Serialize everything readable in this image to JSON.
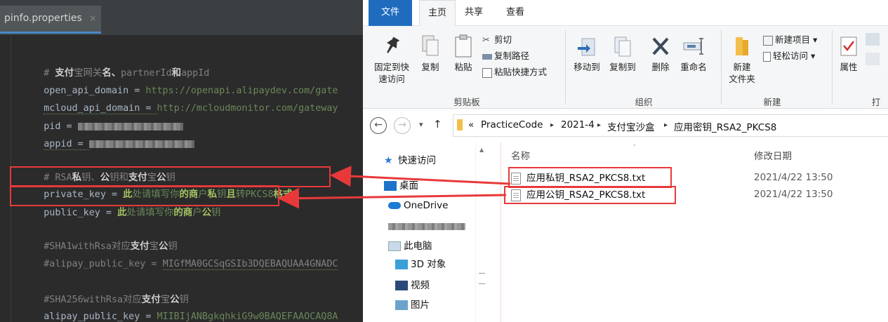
{
  "editor": {
    "tab_title": "pinfo.properties",
    "tab_close": "×",
    "lines": {
      "l1_comment_hash": "# ",
      "l1_p1": "支付",
      "l1_p2": "宝网关",
      "l1_p3": "名、",
      "l1_p4": "partnerId",
      "l1_p5": "和",
      "l1_p6": "appId",
      "l2_key": "open_api_domain = ",
      "l2_val": "https://openapi.alipaydev.com/gate",
      "l3_key": "mcloud_api_domain = ",
      "l3_val": "http://mcloudmonitor.com/gateway",
      "l4_key": "pid = ",
      "l5_key": "appid = ",
      "l6_comment_hash": "# RSA",
      "l6_p1": "私",
      "l6_p2": "钥、",
      "l6_p3": "公",
      "l6_p4": "钥和",
      "l6_p5": "支付",
      "l6_p6": "宝",
      "l6_p7": "公",
      "l6_p8": "钥",
      "l7_key": "private_key = ",
      "l7_p1": "此",
      "l7_p2": "处请填写你",
      "l7_p3": "的商",
      "l7_p4": "户",
      "l7_p5": "私",
      "l7_p6": "钥",
      "l7_p7": "且",
      "l7_p8": "转PKCS8",
      "l7_p9": "格式",
      "l8_key": "public_key = ",
      "l8_p1": "此",
      "l8_p2": "处请填写你",
      "l8_p3": "的商",
      "l8_p4": "户",
      "l8_p5": "公",
      "l8_p6": "钥",
      "l9_p1": "#SHA1withRsa",
      "l9_p2": "对应",
      "l9_p3": "支付",
      "l9_p4": "宝",
      "l9_p5": "公",
      "l9_p6": "钥",
      "l10_key": "#alipay_public_key = ",
      "l10_val": "MIGfMA0GCSqGSIb3DQEBAQUAA4GNADC",
      "l11_p1": "#SHA256withRsa",
      "l11_p2": "对应",
      "l11_p3": "支付",
      "l11_p4": "宝",
      "l11_p5": "公",
      "l11_p6": "钥",
      "l12_key": "alipay_public_key = ",
      "l12_val": "MIIBIjANBgkqhkiG9w0BAQEFAAOCAQ8A"
    }
  },
  "explorer": {
    "tabs": {
      "file": "文件",
      "home": "主页",
      "share": "共享",
      "view": "查看"
    },
    "ribbon": {
      "pin_quick_1": "固定到快",
      "pin_quick_2": "速访问",
      "copy": "复制",
      "paste": "粘贴",
      "cut": "剪切",
      "copy_path": "复制路径",
      "paste_shortcut": "粘贴快捷方式",
      "group_clipboard": "剪贴板",
      "move_to": "移动到",
      "copy_to": "复制到",
      "delete": "删除",
      "rename": "重命名",
      "group_organize": "组织",
      "new_folder_1": "新建",
      "new_folder_2": "文件夹",
      "new_item": "新建项目 ▾",
      "easy_access": "轻松访问 ▾",
      "group_new": "新建",
      "properties": "属性",
      "group_open_partial": "打"
    },
    "address": {
      "back": "←",
      "forward": "→",
      "dropdown": "▾",
      "up": "↑",
      "overflow": "«",
      "crumbs": [
        "PracticeCode",
        "2021-4",
        "支付宝沙盒",
        "应用密钥_RSA2_PKCS8"
      ],
      "sep": "▸"
    },
    "nav": {
      "quick_access": "快速访问",
      "desktop": "桌面",
      "onedrive": "OneDrive",
      "this_pc": "此电脑",
      "objects3d": "3D 对象",
      "videos": "视频",
      "pictures": "图片"
    },
    "columns": {
      "name": "名称",
      "date": "修改日期"
    },
    "files": [
      {
        "name": "应用私钥_RSA2_PKCS8.txt",
        "date": "2021/4/22 13:50"
      },
      {
        "name": "应用公钥_RSA2_PKCS8.txt",
        "date": "2021/4/22 13:50"
      }
    ]
  },
  "colors": {
    "annotation_red": "#e8393a",
    "editor_bg": "#2b2b2b",
    "file_tab_blue": "#1f6cbf"
  }
}
